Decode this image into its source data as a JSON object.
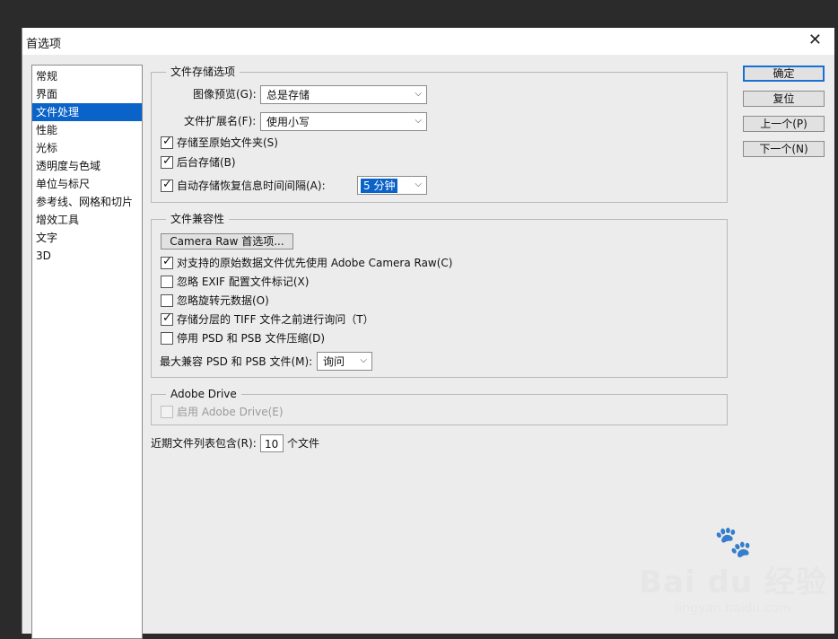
{
  "dialog": {
    "title": "首选项",
    "close_glyph": "✕"
  },
  "nav": {
    "items": [
      "常规",
      "界面",
      "文件处理",
      "性能",
      "光标",
      "透明度与色域",
      "单位与标尺",
      "参考线、网格和切片",
      "增效工具",
      "文字",
      "3D"
    ],
    "selected": "文件处理"
  },
  "file_save": {
    "legend": "文件存储选项",
    "image_preview": {
      "label": "图像预览(G):",
      "value": "总是存储"
    },
    "file_extension": {
      "label": "文件扩展名(F):",
      "value": "使用小写"
    },
    "save_to_original": {
      "label": "存储至原始文件夹(S)",
      "checked": true
    },
    "background_save": {
      "label": "后台存储(B)",
      "checked": true
    },
    "autosave": {
      "label": "自动存储恢复信息时间间隔(A):",
      "checked": true,
      "value": "5 分钟"
    }
  },
  "compat": {
    "legend": "文件兼容性",
    "camera_raw_button": "Camera Raw 首选项...",
    "options": [
      {
        "label": "对支持的原始数据文件优先使用 Adobe Camera Raw(C)",
        "checked": true
      },
      {
        "label": "忽略 EXIF 配置文件标记(X)",
        "checked": false
      },
      {
        "label": "忽略旋转元数据(O)",
        "checked": false
      },
      {
        "label": "存储分层的 TIFF 文件之前进行询问（T）",
        "checked": true
      },
      {
        "label": "停用 PSD 和 PSB 文件压缩(D)",
        "checked": false
      }
    ],
    "max_compat": {
      "label": "最大兼容 PSD 和 PSB 文件(M):",
      "value": "询问"
    }
  },
  "adobe_drive": {
    "legend": "Adobe Drive",
    "enable": {
      "label": "启用 Adobe Drive(E)",
      "checked": false,
      "disabled": true
    }
  },
  "recent_files": {
    "label": "近期文件列表包含(R):",
    "value": "10",
    "suffix": "个文件"
  },
  "buttons": {
    "ok": "确定",
    "reset": "复位",
    "prev": "上一个(P)",
    "next": "下一个(N)"
  },
  "icons": {
    "check": "✓",
    "chevron": "⌵",
    "watermark_paw": "🐾"
  },
  "watermark": {
    "brand": "Bai du 经验",
    "url": "jingyan.baidu.com"
  }
}
